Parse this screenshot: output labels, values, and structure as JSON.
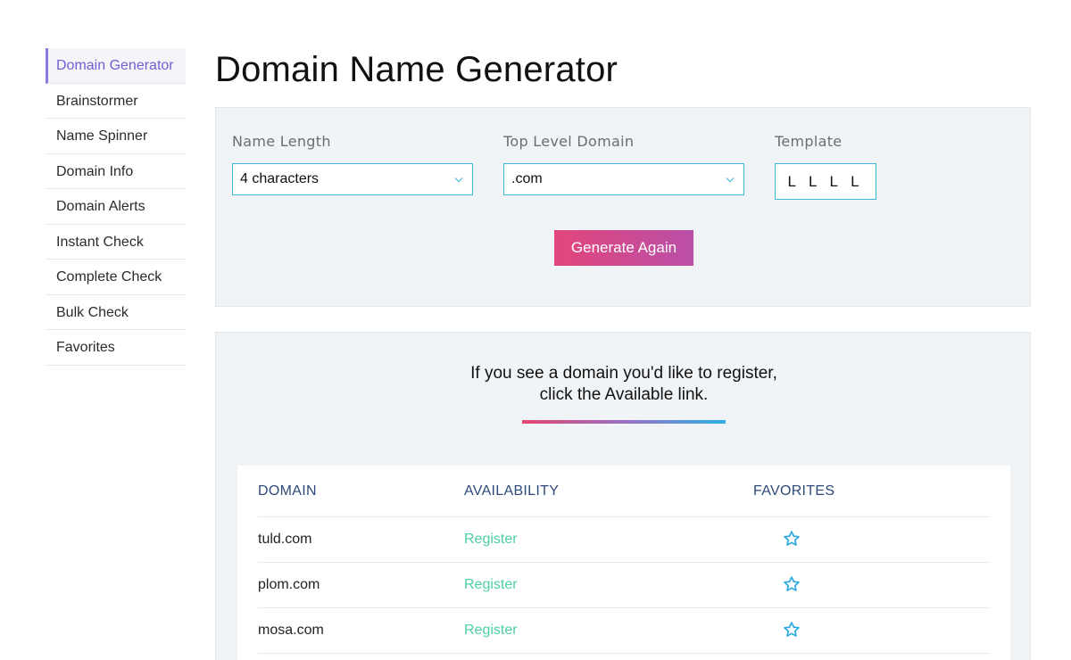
{
  "sidebar": {
    "items": [
      {
        "label": "Domain Generator",
        "active": true
      },
      {
        "label": "Brainstormer"
      },
      {
        "label": "Name Spinner"
      },
      {
        "label": "Domain Info"
      },
      {
        "label": "Domain Alerts"
      },
      {
        "label": "Instant Check"
      },
      {
        "label": "Complete Check"
      },
      {
        "label": "Bulk Check"
      },
      {
        "label": "Favorites"
      }
    ]
  },
  "page": {
    "title": "Domain Name Generator"
  },
  "controls": {
    "name_length": {
      "label": "Name Length",
      "value": "4 characters"
    },
    "tld": {
      "label": "Top Level Domain",
      "value": ".com"
    },
    "template": {
      "label": "Template",
      "value": "L L L L"
    },
    "generate_label": "Generate Again"
  },
  "results": {
    "info_line1": "If you see a domain you'd like to register,",
    "info_line2": "click the Available link.",
    "headers": {
      "domain": "DOMAIN",
      "availability": "AVAILABILITY",
      "favorites": "FAVORITES"
    },
    "rows": [
      {
        "domain": "tuld.com",
        "availability": "Register"
      },
      {
        "domain": "plom.com",
        "availability": "Register"
      },
      {
        "domain": "mosa.com",
        "availability": "Register"
      }
    ]
  },
  "colors": {
    "accent_purple": "#6f5fd3",
    "select_border": "#3fb7d8",
    "register_green": "#4ccfa8",
    "star_blue": "#2aa8e0",
    "header_navy": "#2f4a7a"
  },
  "icons": {
    "favorite": "star-outline-icon",
    "select": "chevron-down-icon"
  }
}
